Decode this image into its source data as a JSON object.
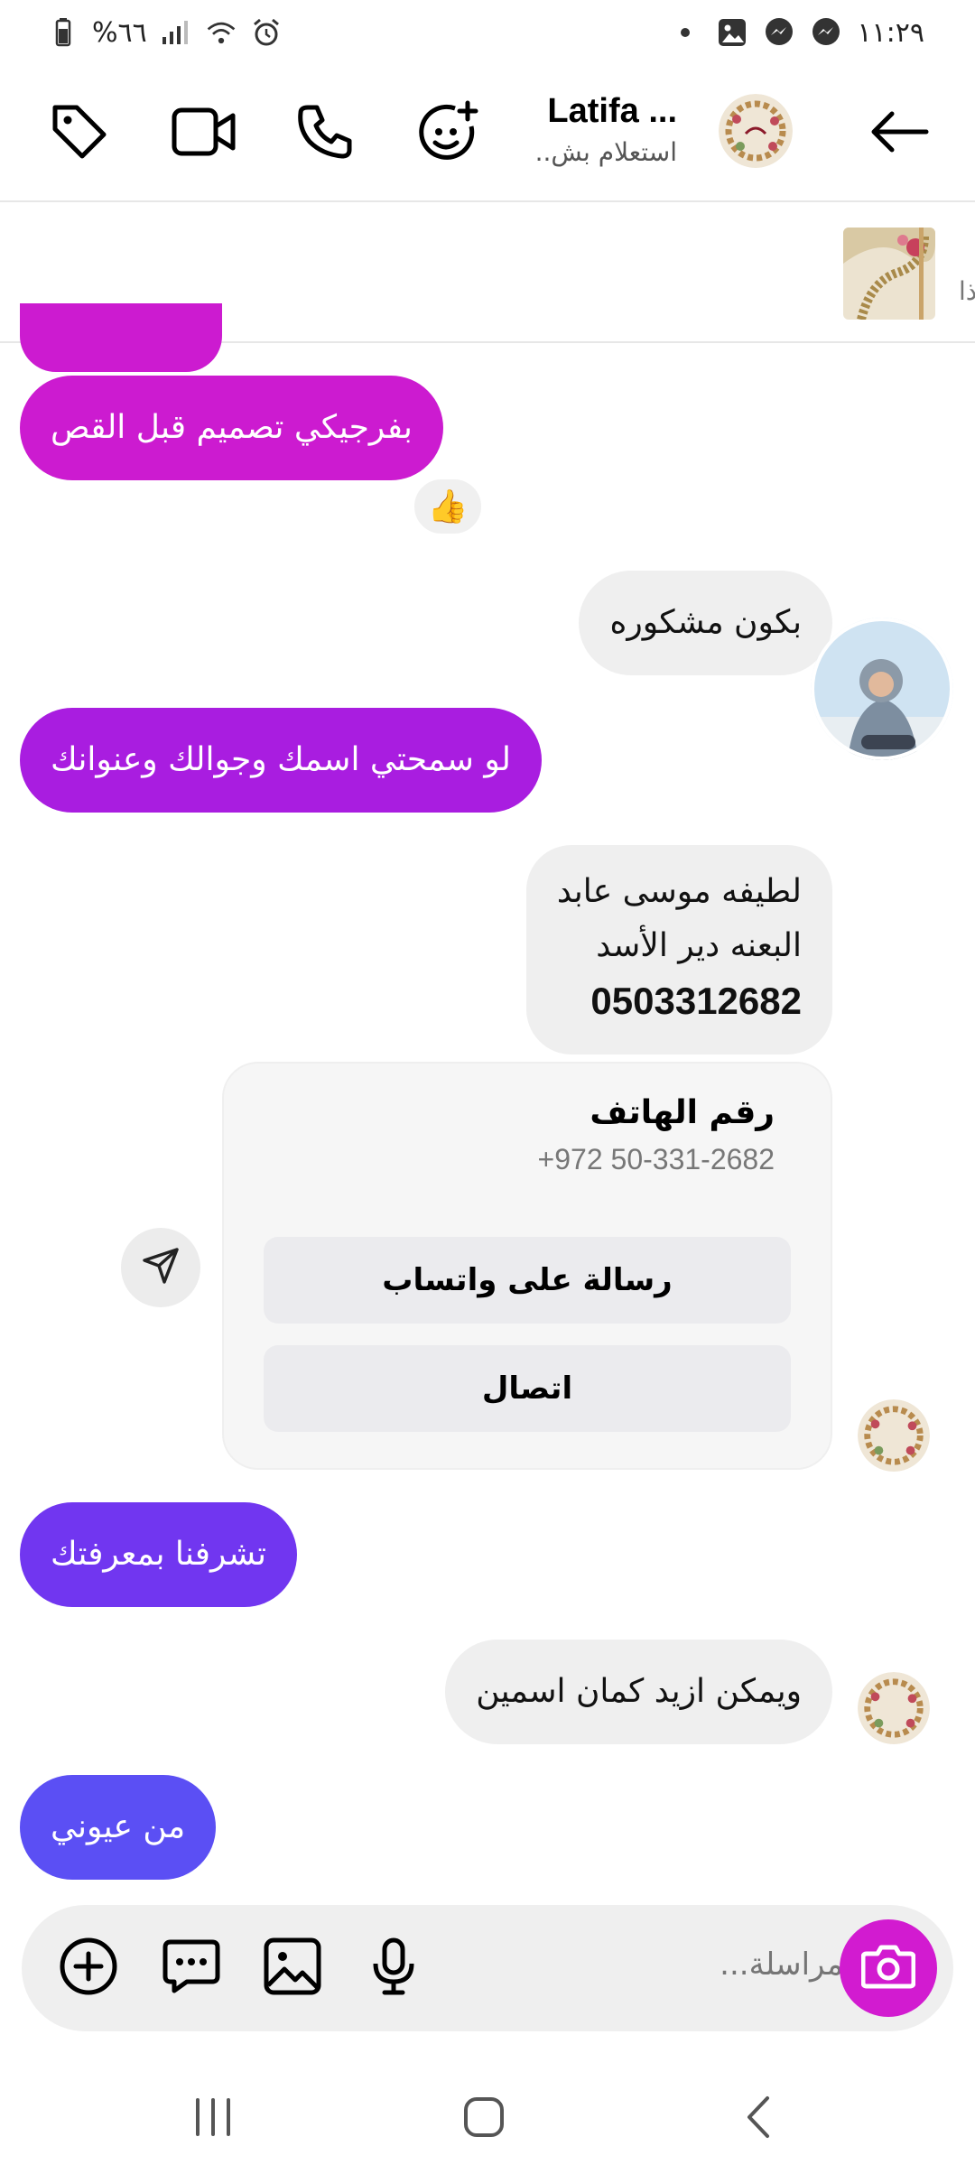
{
  "status_bar": {
    "time": "١١:٢٩",
    "battery_percent": "%٦٦",
    "icons": [
      "dot-icon",
      "gallery-icon",
      "messenger-icon",
      "messenger-icon",
      "alarm-icon",
      "wifi-icon",
      "signal-icon",
      "battery-icon"
    ]
  },
  "header": {
    "contact_name": "Latifa ...",
    "contact_status": "استعلام بش..",
    "icons": [
      "back-arrow-icon",
      "emoji-add-icon",
      "phone-icon",
      "video-icon",
      "tag-icon"
    ]
  },
  "pinned": {
    "edge_text": "ذا"
  },
  "messages": [
    {
      "id": "m1",
      "direction": "out",
      "text": "بفرجيكي تصميم قبل القص",
      "color": "#cc1bd0"
    },
    {
      "id": "m2",
      "direction": "in",
      "text": "بكون مشكوره"
    },
    {
      "id": "m3",
      "direction": "out",
      "text": "لو سمحتي اسمك وجوالك وعنوانك",
      "color": "#a91de0"
    },
    {
      "id": "m4",
      "direction": "in",
      "line1": "لطيفه موسى عابد",
      "line2": "البعنه دير الأسد",
      "line3": "0503312682"
    },
    {
      "id": "m5",
      "direction": "out",
      "text": "تشرفنا بمعرفتك",
      "color": "#7136f0"
    },
    {
      "id": "m6",
      "direction": "in",
      "text": "ويمكن ازيد كمان اسمين"
    },
    {
      "id": "m7",
      "direction": "out",
      "text": "من عيوني",
      "color": "#5b4ff4"
    }
  ],
  "reaction": {
    "emoji": "👍"
  },
  "phone_card": {
    "title": "رقم الهاتف",
    "phone": "+972 50-331-2682",
    "whatsapp_label": "رسالة على واتساب",
    "call_label": "اتصال"
  },
  "composer": {
    "placeholder": "مراسلة...",
    "accent": "#d21bd0"
  }
}
